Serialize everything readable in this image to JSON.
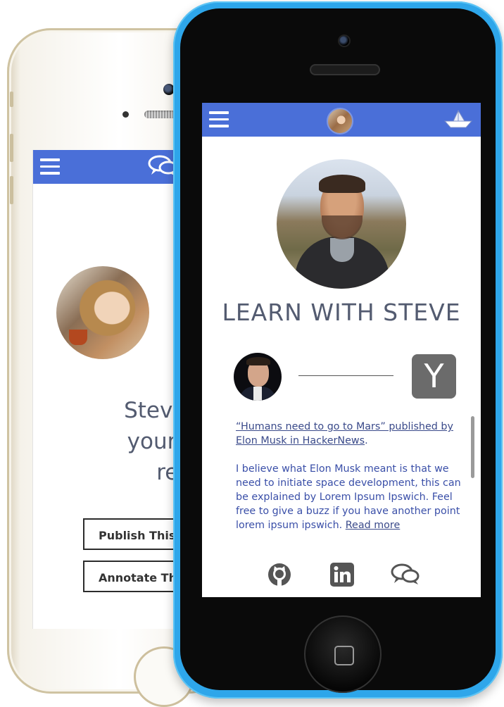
{
  "back_phone": {
    "message_lines": [
      "Steve has a",
      "your conve",
      "reque"
    ],
    "buttons": [
      "Publish This C",
      "Annotate This C"
    ]
  },
  "front_phone": {
    "title": "LEARN WITH STEVE",
    "source_badge": "Y",
    "post_link": "“Humans need to go to Mars” published by Elon Musk in HackerNews",
    "post_link_suffix": ".",
    "post_body": "I believe what Elon Musk meant is that we need to initiate space development, this can be explained by Lorem Ipsum Ipswich. Feel free to give a buzz if you have another point lorem ipsum ipswich.",
    "read_more": "Read more"
  },
  "icons": {
    "menu": "hamburger-icon",
    "chat": "chat-bubbles-icon",
    "boat": "paper-boat-icon",
    "github": "github-icon",
    "linkedin": "linkedin-icon"
  },
  "colors": {
    "accent": "#4a6fd8",
    "phone_blue": "#2ea6ea",
    "text": "#535b70",
    "link": "#3a4a8a"
  }
}
